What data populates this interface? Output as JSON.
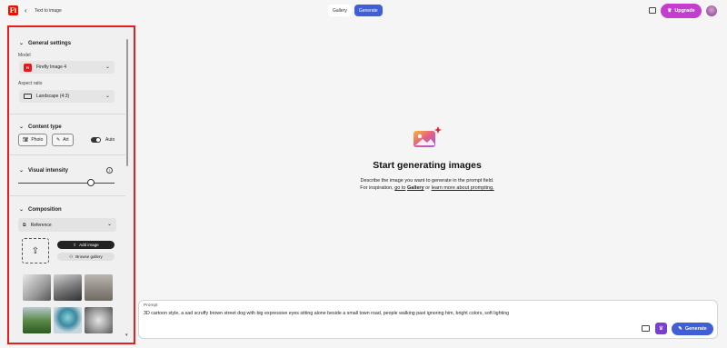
{
  "header": {
    "logo_text": "Fi",
    "breadcrumb": "Text to image",
    "tabs": [
      {
        "label": "Gallery",
        "active": false
      },
      {
        "label": "Generate",
        "active": true
      }
    ],
    "upgrade_label": "Upgrade"
  },
  "sidebar": {
    "general": {
      "title": "General settings",
      "model_label": "Model",
      "model_value": "Firefly Image 4",
      "aspect_label": "Aspect ratio",
      "aspect_value": "Landscape (4:3)"
    },
    "content_type": {
      "title": "Content type",
      "options": [
        "Photo",
        "Art"
      ],
      "auto_label": "Auto"
    },
    "visual_intensity": {
      "title": "Visual intensity",
      "level": 0.75
    },
    "composition": {
      "title": "Composition",
      "reference_label": "Reference",
      "add_image_label": "Add image",
      "browse_gallery_label": "Browse gallery"
    }
  },
  "main": {
    "headline": "Start generating images",
    "line1": "Describe the image you want to generate in the prompt field.",
    "line2_prefix": "For inspiration,",
    "line2_goto": "go to",
    "line2_gallery": "Gallery",
    "line2_or": "or",
    "line2_learn": "learn more about prompting."
  },
  "prompt": {
    "label": "Prompt",
    "text": "3D cartoon style, a sad scruffy brown street dog with big expressive eyes sitting alone beside a small town road, people walking past ignoring him, bright colors, soft lighting",
    "generate_label": "Generate"
  },
  "colors": {
    "accent": "#3f5fd9",
    "upgrade": "#c33dcf",
    "highlight": "#e41f1f"
  }
}
